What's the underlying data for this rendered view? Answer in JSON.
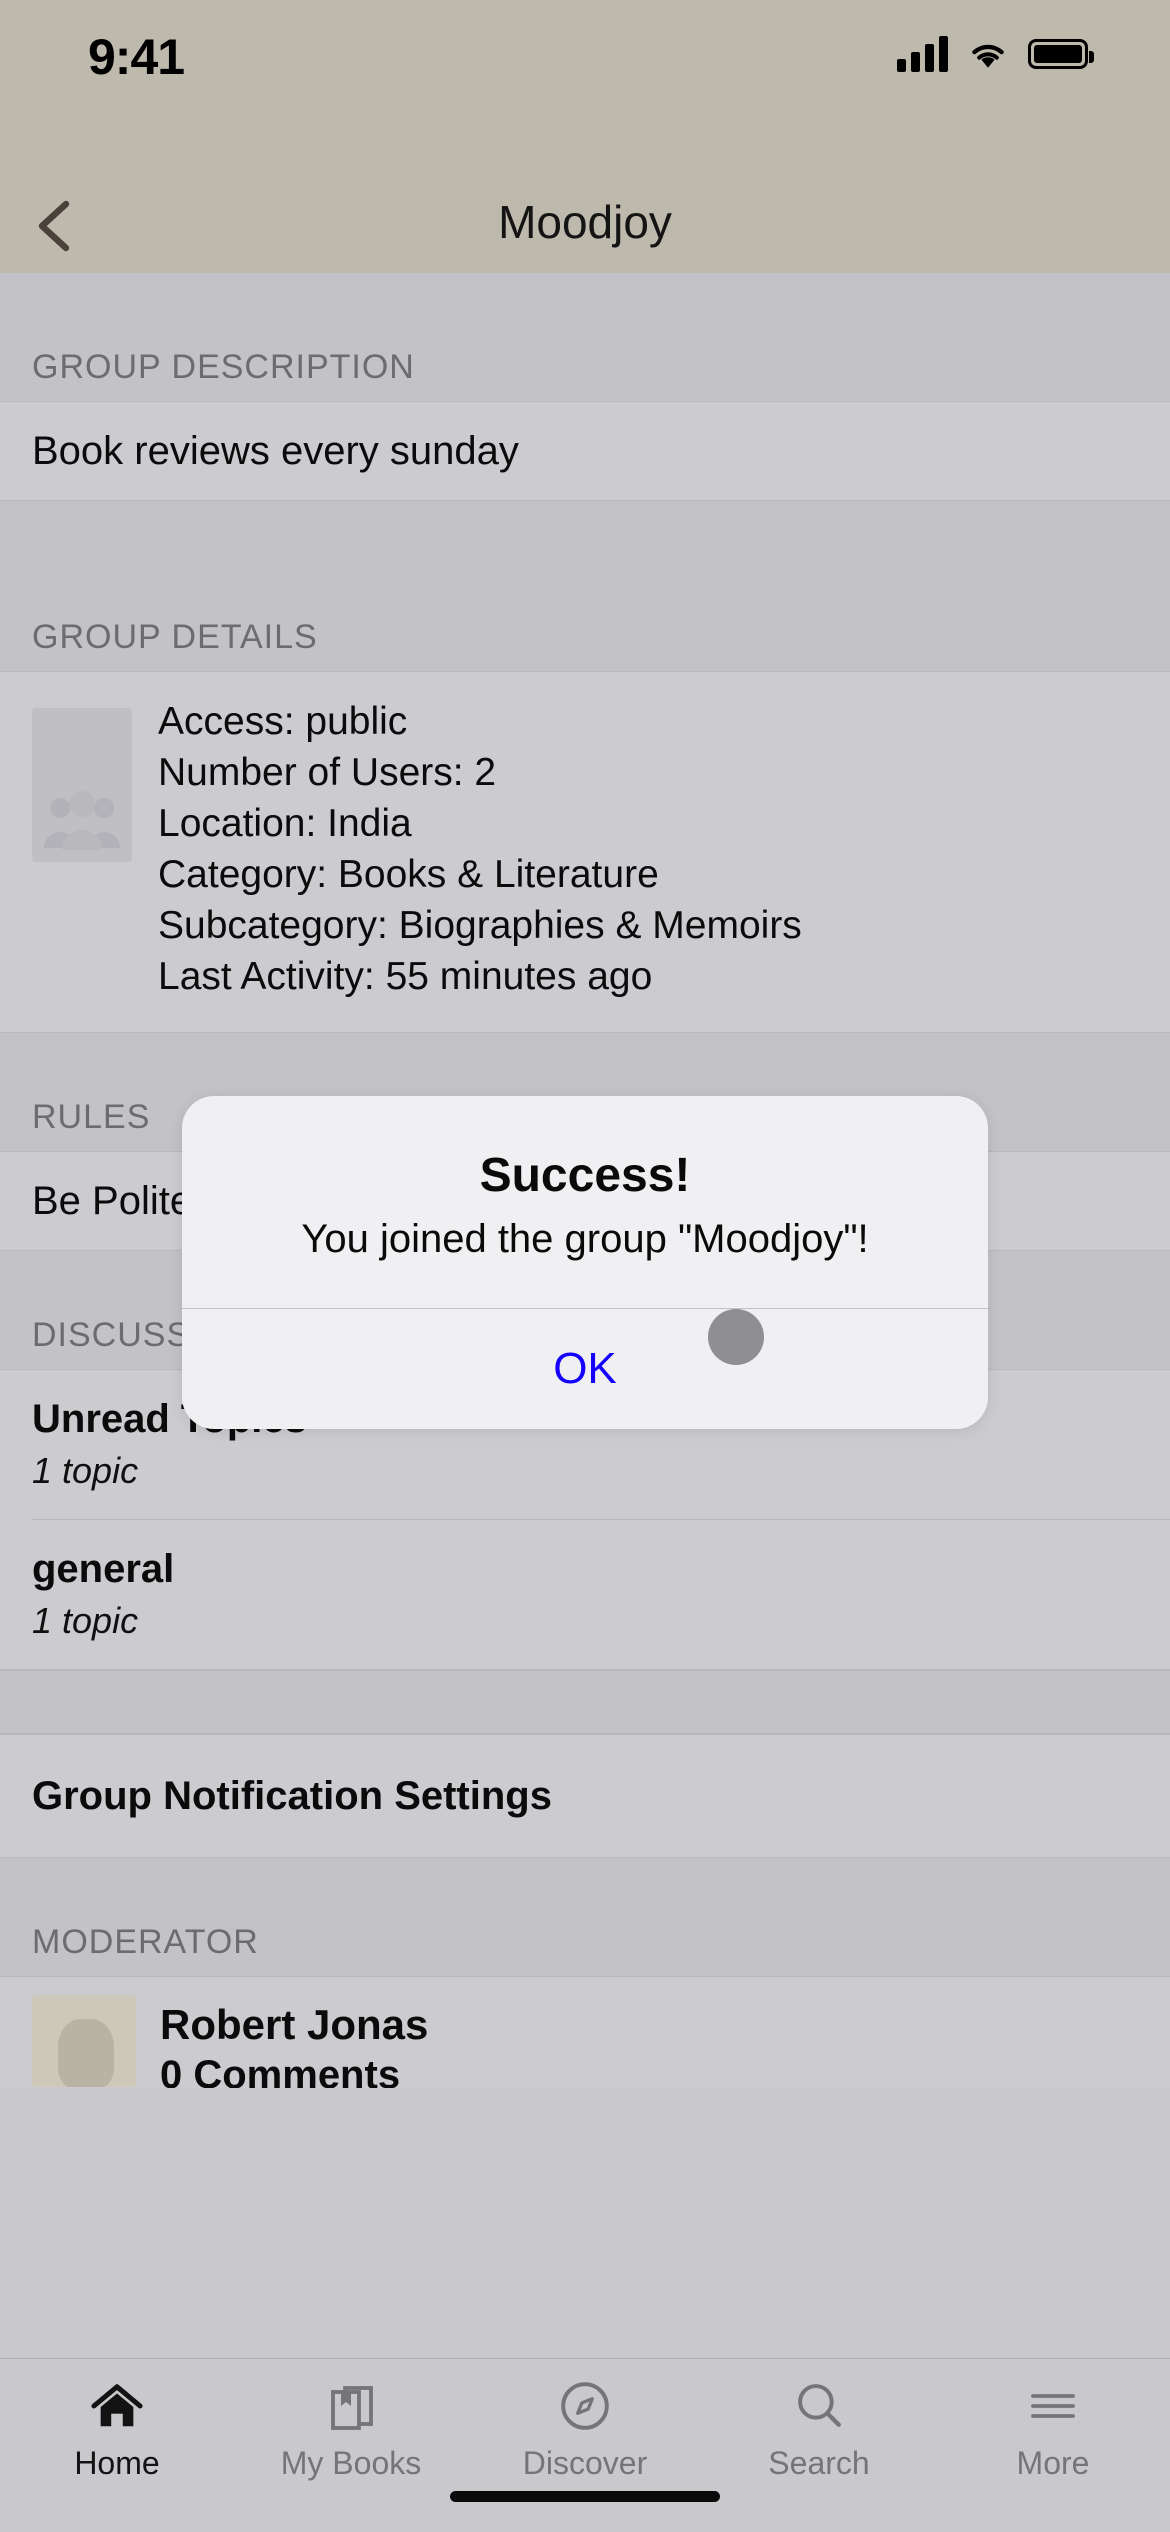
{
  "status_bar": {
    "time": "9:41",
    "cellular_icon": "signal-bars-icon",
    "wifi_icon": "wifi-icon",
    "battery_icon": "battery-icon"
  },
  "nav": {
    "back_icon": "back-chevron-icon",
    "title": "Moodjoy"
  },
  "sections": {
    "group_description": {
      "header": "GROUP DESCRIPTION",
      "text": "Book reviews every sunday"
    },
    "group_details": {
      "header": "GROUP DETAILS",
      "avatar_icon": "group-people-placeholder-icon",
      "lines": [
        "Access: public",
        "Number of Users: 2",
        "Location: India",
        "Category: Books & Literature",
        "Subcategory: Biographies & Memoirs",
        "Last Activity: 55 minutes ago"
      ]
    },
    "rules": {
      "header": "RULES",
      "items": [
        "Be Polite"
      ]
    },
    "discussions": {
      "header": "DISCUSSIONS",
      "items": [
        {
          "title": "Unread Topics",
          "subtitle": "1 topic"
        },
        {
          "title": "general",
          "subtitle": "1 topic"
        }
      ]
    },
    "settings": {
      "label": "Group Notification Settings"
    },
    "moderator": {
      "header": "MODERATOR",
      "name": "Robert Jonas",
      "comments": "0 Comments"
    }
  },
  "alert": {
    "title": "Success!",
    "message": "You joined the group \"Moodjoy\"!",
    "ok_label": "OK",
    "ok_color": "#1400ff"
  },
  "cursor": {
    "name": "touch-indicator"
  },
  "tab_bar": {
    "items": [
      {
        "label": "Home",
        "icon": "home-icon",
        "active": true
      },
      {
        "label": "My Books",
        "icon": "books-icon",
        "active": false
      },
      {
        "label": "Discover",
        "icon": "compass-icon",
        "active": false
      },
      {
        "label": "Search",
        "icon": "search-icon",
        "active": false
      },
      {
        "label": "More",
        "icon": "hamburger-menu-icon",
        "active": false
      }
    ]
  }
}
